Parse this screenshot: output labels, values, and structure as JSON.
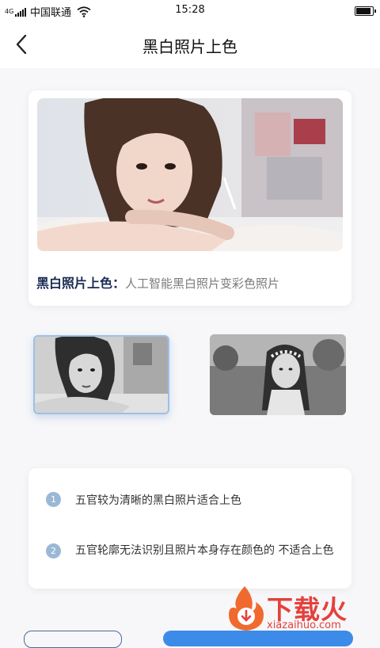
{
  "status_bar": {
    "network_type": "4G",
    "carrier": "中国联通",
    "time": "15:28"
  },
  "nav": {
    "title": "黑白照片上色",
    "back_icon": "chevron-left-icon"
  },
  "hero": {
    "caption_title": "黑白照片上色：",
    "caption_desc": "人工智能黑白照片变彩色照片"
  },
  "samples": [
    {
      "selected": true
    },
    {
      "selected": false
    }
  ],
  "tips": [
    {
      "num": "1",
      "text": "五官较为清晰的黑白照片适合上色"
    },
    {
      "num": "2",
      "text": "五官轮廓无法识别且照片本身存在颜色的 不适合上色"
    }
  ],
  "watermark": {
    "text": "下载火",
    "url": "xiazaihuo.com"
  },
  "colors": {
    "accent": "#3d8be8",
    "tip_badge": "#9ab8d6",
    "caption_title": "#1a2a52",
    "watermark": "#e4413c"
  }
}
